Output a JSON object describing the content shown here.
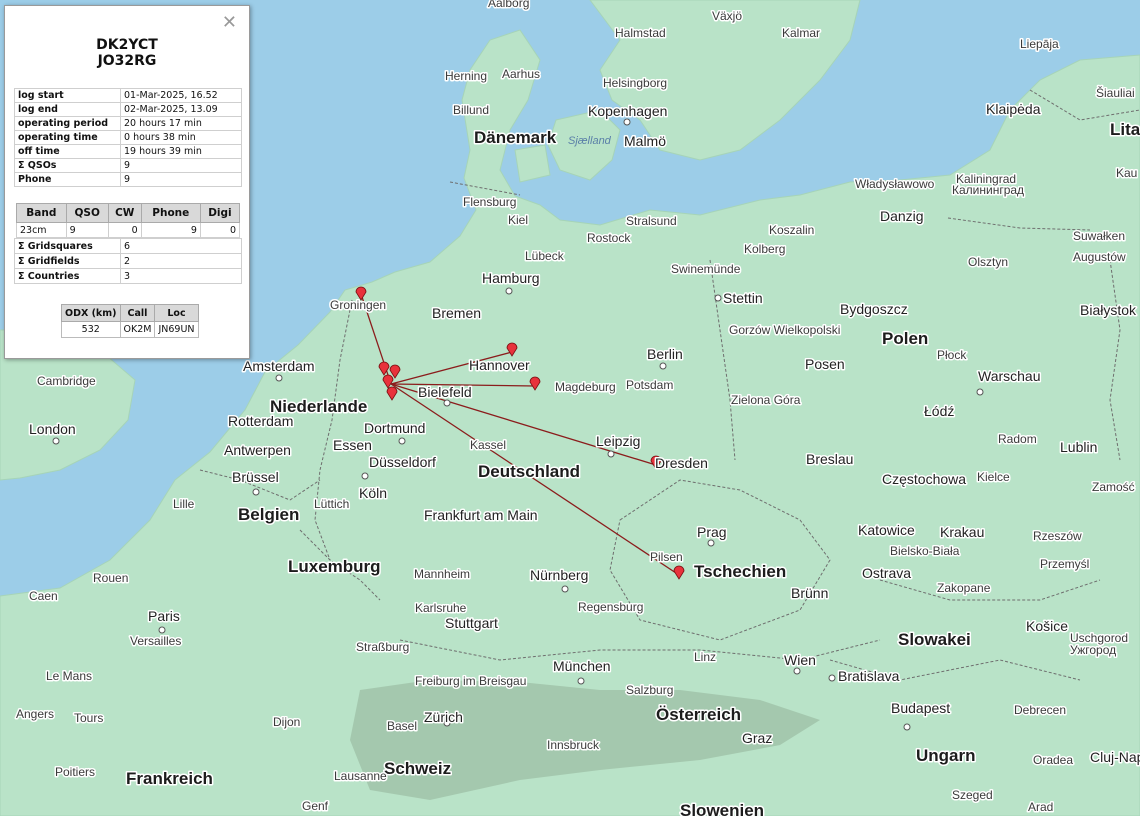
{
  "station": {
    "call": "DK2YCT",
    "locator": "JO32RG"
  },
  "close_icon": "close-icon",
  "stats": [
    {
      "key": "log start",
      "value": "01-Mar-2025, 16.52"
    },
    {
      "key": "log end",
      "value": "02-Mar-2025, 13.09"
    },
    {
      "key": "operating period",
      "value": "20 hours 17 min"
    },
    {
      "key": "operating time",
      "value": "0 hours 38 min"
    },
    {
      "key": "off time",
      "value": "19 hours 39 min"
    },
    {
      "key": "Σ QSOs",
      "value": "9"
    },
    {
      "key": "Phone",
      "value": "9"
    }
  ],
  "band_table": {
    "headers": [
      "Band",
      "QSO",
      "CW",
      "Phone",
      "Digi"
    ],
    "rows": [
      [
        "23cm",
        "9",
        "0",
        "9",
        "0"
      ]
    ]
  },
  "stats2": [
    {
      "key": "Σ Gridsquares",
      "value": "6"
    },
    {
      "key": "Σ Gridfields",
      "value": "2"
    },
    {
      "key": "Σ Countries",
      "value": "3"
    }
  ],
  "odx": {
    "headers": [
      "ODX (km)",
      "Call",
      "Loc"
    ],
    "row": [
      "532",
      "OK2M",
      "JN69UN"
    ]
  },
  "map": {
    "countries": [
      "Dänemark",
      "Niederlande",
      "Belgien",
      "Luxemburg",
      "Deutschland",
      "Polen",
      "Tschechien",
      "Slowakei",
      "Österreich",
      "Ungarn",
      "Schweiz",
      "Frankreich",
      "Lita"
    ],
    "cities": [
      "Aalborg",
      "Växjö",
      "Halmstad",
      "Kalmar",
      "Liepāja",
      "Herning",
      "Aarhus",
      "Helsingborg",
      "Billund",
      "Kopenhagen",
      "Malmö",
      "Sjælland",
      "Klaipėda",
      "Šiauliai",
      "Kau",
      "Flensburg",
      "Kiel",
      "Stralsund",
      "Władysławowo",
      "Danzig",
      "Kaliningrad",
      "Калининград",
      "Rostock",
      "Koszalin",
      "Kolberg",
      "Suwałken",
      "Augustów",
      "Lübeck",
      "Olsztyn",
      "Hamburg",
      "Swinemünde",
      "Stettin",
      "Bydgoszcz",
      "Białystok",
      "Groningen",
      "Bremen",
      "Gorzów Wielkopolski",
      "Amsterdam",
      "Hannover",
      "Berlin",
      "Posen",
      "Płock",
      "Warschau",
      "Cambridge",
      "Magdeburg",
      "Potsdam",
      "Bielefeld",
      "Zielona Góra",
      "Łódź",
      "Rotterdam",
      "London",
      "Dortmund",
      "Radom",
      "Lublin",
      "Essen",
      "Leipzig",
      "Antwerpen",
      "Kassel",
      "Düsseldorf",
      "Dresden",
      "Breslau",
      "Brüssel",
      "Köln",
      "Kielce",
      "Częstochowa",
      "Zamość",
      "Lille",
      "Lüttich",
      "Frankfurt am Main",
      "Prag",
      "Katowice",
      "Krakau",
      "Rzeszów",
      "Bielsko-Biała",
      "Przemyśl",
      "Pilsen",
      "Ostrava",
      "Mannheim",
      "Nürnberg",
      "Caen",
      "Rouen",
      "Zakopane",
      "Brünn",
      "Paris",
      "Versailles",
      "Karlsruhe",
      "Stuttgart",
      "Regensburg",
      "Košice",
      "Uschgorod",
      "Ужгород",
      "Straßburg",
      "Linz",
      "Wien",
      "Bratislava",
      "München",
      "Le Mans",
      "Freiburg im Breisgau",
      "Salzburg",
      "Angers",
      "Tours",
      "Dijon",
      "Basel",
      "Zürich",
      "Innsbruck",
      "Graz",
      "Budapest",
      "Debrecen",
      "Cluj-Nap",
      "Poitiers",
      "Lausanne",
      "Oradea",
      "Szeged",
      "Genf",
      "Arad",
      "Slowenien",
      "Dänemark"
    ],
    "colors": {
      "water": "#9ccde8",
      "land": "#b9e3c8",
      "path": "#8b1c1c",
      "marker": "#e8323c"
    }
  }
}
